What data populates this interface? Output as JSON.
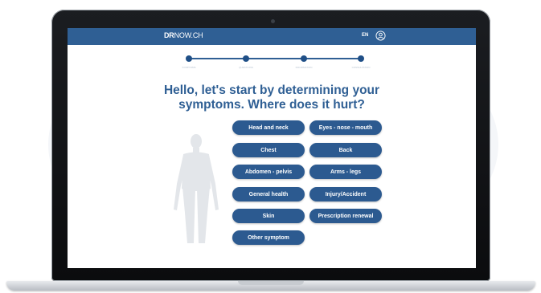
{
  "brand": {
    "bold": "DR",
    "light": "NOW",
    "suffix": ".CH"
  },
  "language": "EN",
  "progress": {
    "current_step": 1,
    "total_steps": 4,
    "step_labels": [
      "SYMPTOMS",
      "QUESTIONS",
      "INFORMATION",
      "CONSULTATION"
    ]
  },
  "headline": {
    "line1": "Hello, let's start by determining your",
    "line2": "symptoms. Where does it hurt?"
  },
  "options": [
    "Head and neck",
    "Eyes - nose - mouth",
    "Chest",
    "Back",
    "Abdomen - pelvis",
    "Arms - legs",
    "General health",
    "Injury/Accident",
    "Skin",
    "Prescription renewal",
    "Other symptom"
  ],
  "colors": {
    "primary": "#2f5f94",
    "button": "#2c5a90",
    "silhouette": "#e3e6ea"
  },
  "icons": {
    "account": "user-circle-icon"
  }
}
